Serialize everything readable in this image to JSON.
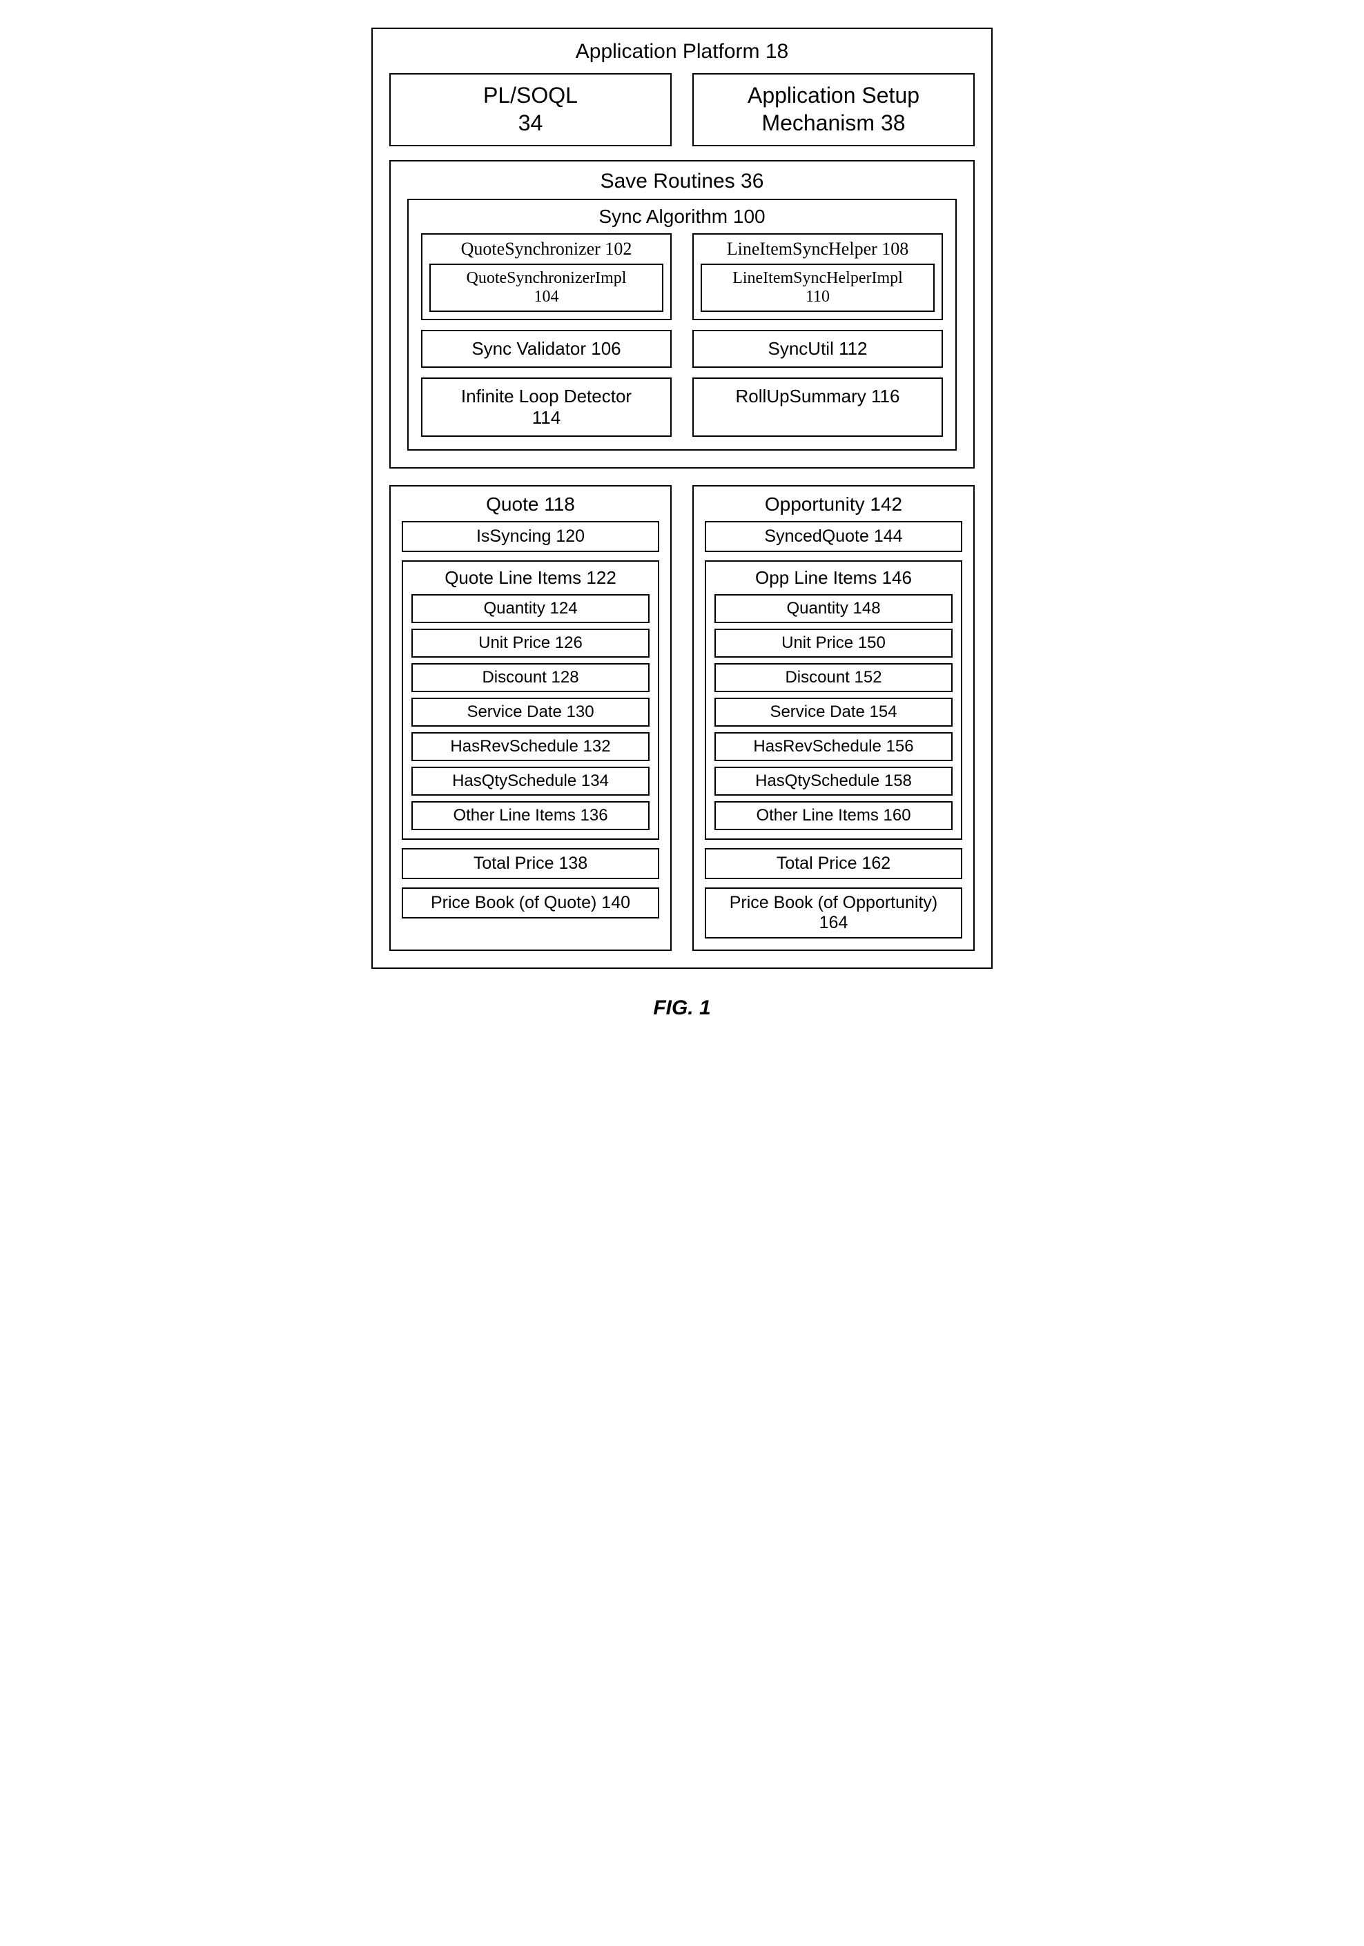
{
  "platform": {
    "title": "Application Platform 18",
    "plsoql": "PL/SOQL\n34",
    "appsetup": "Application Setup\nMechanism 38"
  },
  "saveRoutines": {
    "title": "Save Routines 36",
    "syncAlg": {
      "title": "Sync Algorithm 100",
      "qs": "QuoteSynchronizer 102",
      "qsImpl": "QuoteSynchronizerImpl\n104",
      "lish": "LineItemSyncHelper 108",
      "lishImpl": "LineItemSyncHelperImpl\n110",
      "syncValidator": "Sync Validator 106",
      "syncUtil": "SyncUtil 112",
      "infLoop": "Infinite Loop Detector\n114",
      "rollup": "RollUpSummary 116"
    }
  },
  "quote": {
    "title": "Quote 118",
    "isSyncing": "IsSyncing 120",
    "lineItems": {
      "title": "Quote Line Items 122",
      "quantity": "Quantity 124",
      "unitPrice": "Unit Price 126",
      "discount": "Discount 128",
      "serviceDate": "Service Date 130",
      "hasRev": "HasRevSchedule 132",
      "hasQty": "HasQtySchedule 134",
      "other": "Other Line Items 136"
    },
    "totalPrice": "Total Price 138",
    "priceBook": "Price Book (of Quote) 140"
  },
  "opp": {
    "title": "Opportunity 142",
    "syncedQuote": "SyncedQuote 144",
    "lineItems": {
      "title": "Opp Line Items 146",
      "quantity": "Quantity 148",
      "unitPrice": "Unit Price 150",
      "discount": "Discount 152",
      "serviceDate": "Service Date 154",
      "hasRev": "HasRevSchedule 156",
      "hasQty": "HasQtySchedule 158",
      "other": "Other Line Items 160"
    },
    "totalPrice": "Total Price 162",
    "priceBook": "Price Book (of Opportunity)\n164"
  },
  "figCaption": "FIG. 1"
}
